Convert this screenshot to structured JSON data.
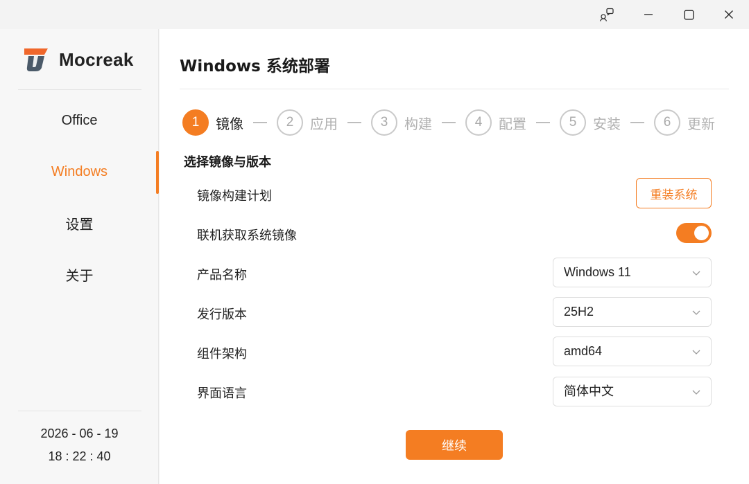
{
  "app": {
    "name": "Mocreak",
    "accent": "#f47d22"
  },
  "titlebar": {
    "icons": [
      "feedback-icon",
      "minimize-icon",
      "maximize-icon",
      "close-icon"
    ]
  },
  "sidebar": {
    "items": [
      {
        "label": "Office",
        "active": false
      },
      {
        "label": "Windows",
        "active": true
      },
      {
        "label": "设置",
        "active": false
      },
      {
        "label": "关于",
        "active": false
      }
    ],
    "date": "2026 - 06 - 19",
    "time": "18 : 22 : 40"
  },
  "main": {
    "title": "Windows 系统部署",
    "steps": [
      {
        "number": "1",
        "label": "镜像",
        "active": true
      },
      {
        "number": "2",
        "label": "应用",
        "active": false
      },
      {
        "number": "3",
        "label": "构建",
        "active": false
      },
      {
        "number": "4",
        "label": "配置",
        "active": false
      },
      {
        "number": "5",
        "label": "安装",
        "active": false
      },
      {
        "number": "6",
        "label": "更新",
        "active": false
      }
    ],
    "section_title": "选择镜像与版本",
    "rows": {
      "build_plan": {
        "label": "镜像构建计划",
        "button": "重装系统"
      },
      "online": {
        "label": "联机获取系统镜像",
        "toggle_on": true
      },
      "product": {
        "label": "产品名称",
        "value": "Windows 11"
      },
      "release": {
        "label": "发行版本",
        "value": "25H2"
      },
      "arch": {
        "label": "组件架构",
        "value": "amd64"
      },
      "language": {
        "label": "界面语言",
        "value": "简体中文"
      }
    },
    "continue_label": "继续"
  }
}
